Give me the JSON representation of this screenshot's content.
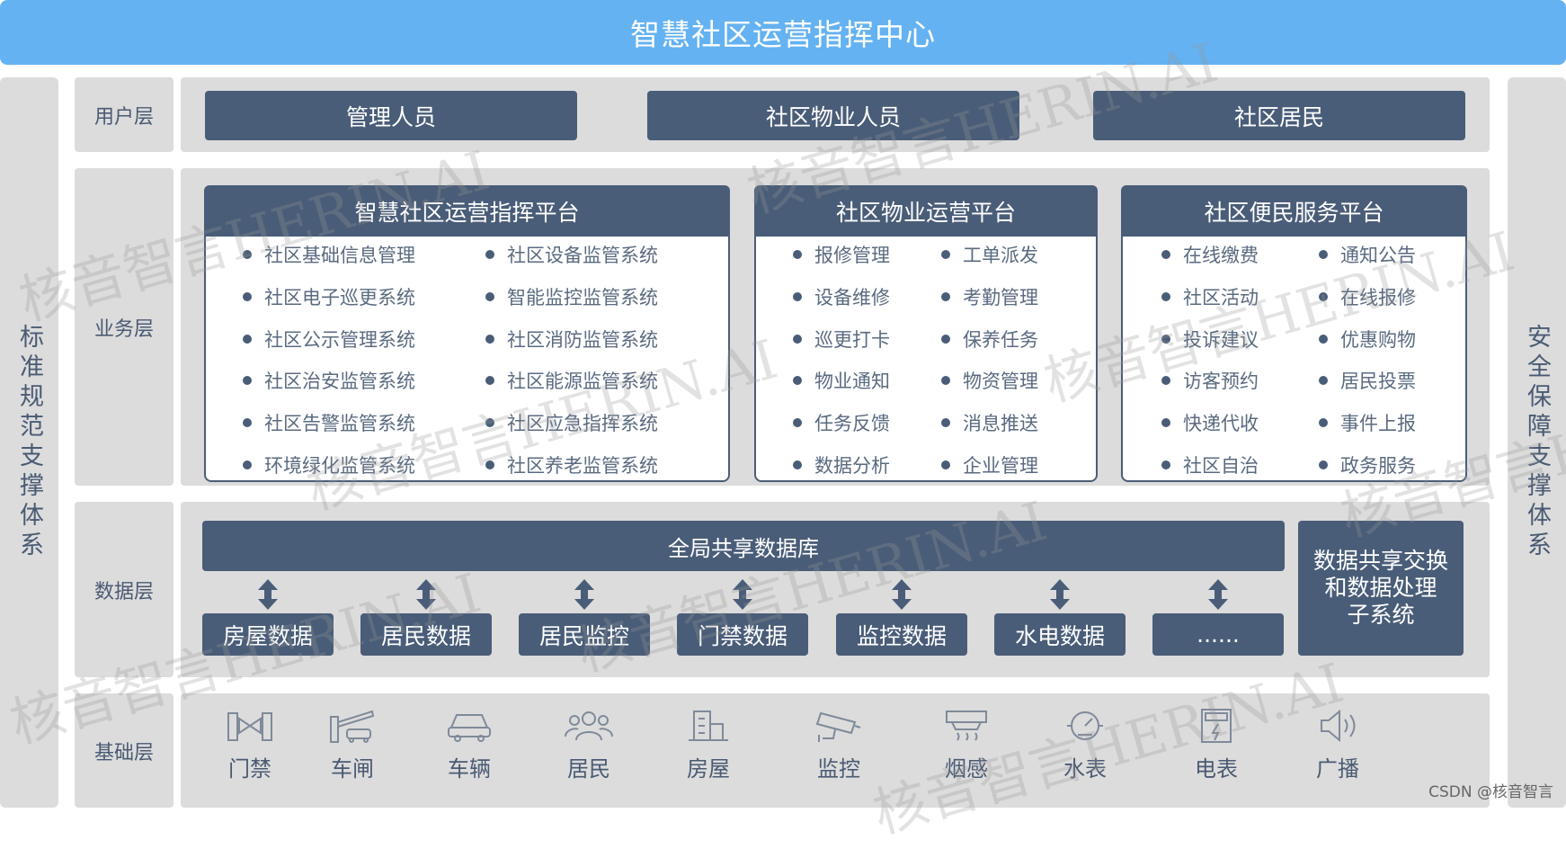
{
  "title": "智慧社区运营指挥中心",
  "left_support": "标准规范支撑体系",
  "right_support": "安全保障支撑体系",
  "layers": {
    "user": "用户层",
    "business": "业务层",
    "data": "数据层",
    "base": "基础层"
  },
  "users": [
    "管理人员",
    "社区物业人员",
    "社区居民"
  ],
  "platforms": [
    {
      "title": "智慧社区运营指挥平台",
      "col1": [
        "社区基础信息管理",
        "社区电子巡更系统",
        "社区公示管理系统",
        "社区治安监管系统",
        "社区告警监管系统",
        "环境绿化监管系统"
      ],
      "col2": [
        "社区设备监管系统",
        "智能监控监管系统",
        "社区消防监管系统",
        "社区能源监管系统",
        "社区应急指挥系统",
        "社区养老监管系统"
      ]
    },
    {
      "title": "社区物业运营平台",
      "col1": [
        "报修管理",
        "设备维修",
        "巡更打卡",
        "物业通知",
        "任务反馈",
        "数据分析"
      ],
      "col2": [
        "工单派发",
        "考勤管理",
        "保养任务",
        "物资管理",
        "消息推送",
        "企业管理"
      ]
    },
    {
      "title": "社区便民服务平台",
      "col1": [
        "在线缴费",
        "社区活动",
        "投诉建议",
        "访客预约",
        "快递代收",
        "社区自治"
      ],
      "col2": [
        "通知公告",
        "在线报修",
        "优惠购物",
        "居民投票",
        "事件上报",
        "政务服务"
      ]
    }
  ],
  "data_layer": {
    "shared_db": "全局共享数据库",
    "items": [
      "房屋数据",
      "居民数据",
      "居民监控",
      "门禁数据",
      "监控数据",
      "水电数据",
      "......"
    ],
    "exchange_line1": "数据共享交换",
    "exchange_line2": "和数据处理",
    "exchange_line3": "子系统"
  },
  "base_layer": [
    {
      "label": "门禁",
      "icon": "gate-icon"
    },
    {
      "label": "车闸",
      "icon": "barrier-icon"
    },
    {
      "label": "车辆",
      "icon": "car-icon"
    },
    {
      "label": "居民",
      "icon": "people-icon"
    },
    {
      "label": "房屋",
      "icon": "building-icon"
    },
    {
      "label": "监控",
      "icon": "camera-icon"
    },
    {
      "label": "烟感",
      "icon": "smoke-detector-icon"
    },
    {
      "label": "水表",
      "icon": "water-meter-icon"
    },
    {
      "label": "电表",
      "icon": "electric-meter-icon"
    },
    {
      "label": "广播",
      "icon": "speaker-icon"
    }
  ],
  "watermark": "核音智言HERIN.AI",
  "credit": "CSDN @核音智言",
  "colors": {
    "title_bg": "#64b2f2",
    "dark_block": "#4a5d78",
    "panel_bg": "#dcdcdc"
  }
}
